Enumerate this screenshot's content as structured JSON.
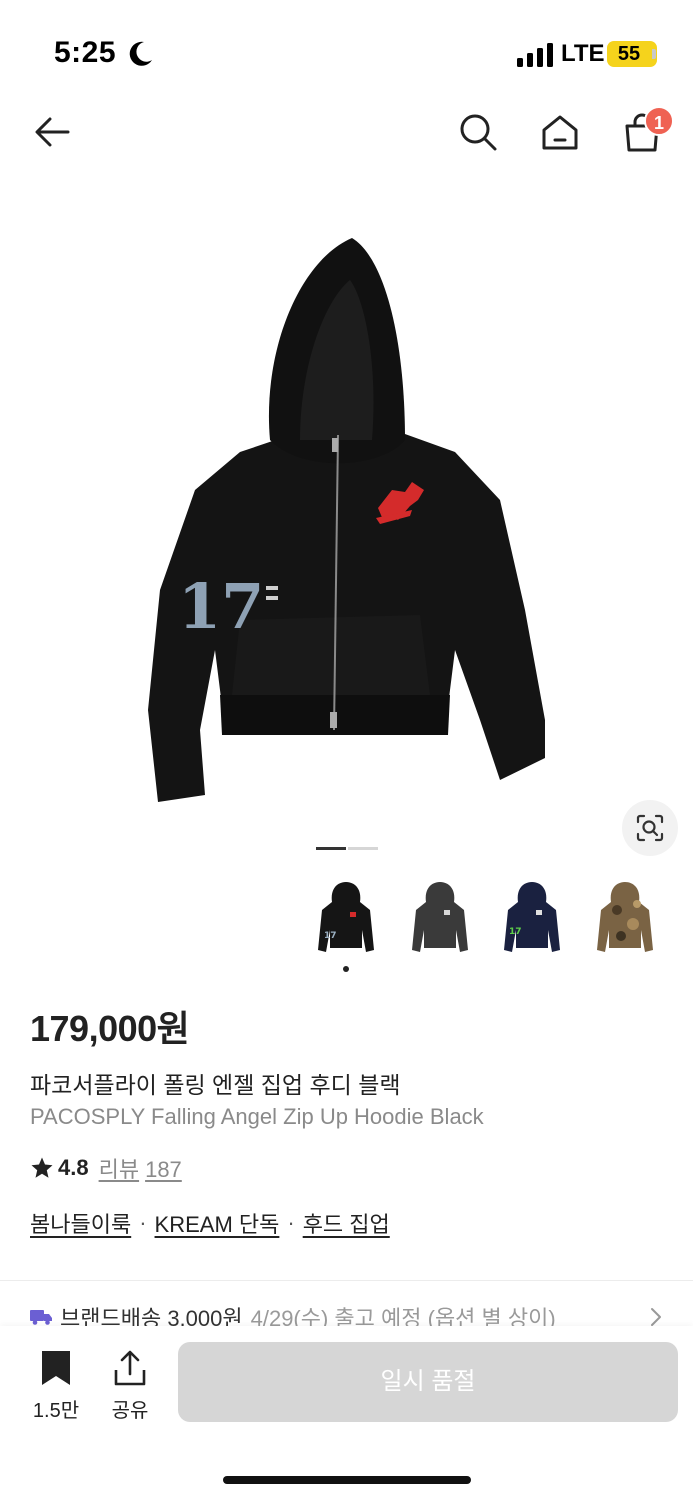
{
  "status_bar": {
    "time": "5:25",
    "network": "LTE",
    "battery": "55"
  },
  "header": {
    "cart_count": "1"
  },
  "gallery": {
    "current_page": 1,
    "total_pages": 2,
    "thumbnails": [
      {
        "color": "black",
        "selected": true
      },
      {
        "color": "charcoal"
      },
      {
        "color": "navy"
      },
      {
        "color": "camo"
      }
    ]
  },
  "product": {
    "price": "179,000원",
    "name_ko": "파코서플라이 폴링 엔젤 집업 후디 블랙",
    "name_en": "PACOSPLY Falling Angel Zip Up Hoodie Black",
    "rating": "4.8",
    "review_label": "리뷰",
    "review_count": "187",
    "tags": [
      "봄나들이룩",
      "KREAM 단독",
      "후드 집업"
    ],
    "tag_separator": "·"
  },
  "shipping": {
    "main": "브랜드배송 3,000원",
    "sub": "4/29(수) 출고 예정 (옵션 별 상이)"
  },
  "bottom_bar": {
    "bookmark_count": "1.5만",
    "share_label": "공유",
    "soldout_label": "일시 품절"
  },
  "colors": {
    "badge": "#ef6253",
    "battery": "#f5d31c",
    "button_disabled": "#d6d6d6",
    "truck": "#6b5fd3"
  }
}
